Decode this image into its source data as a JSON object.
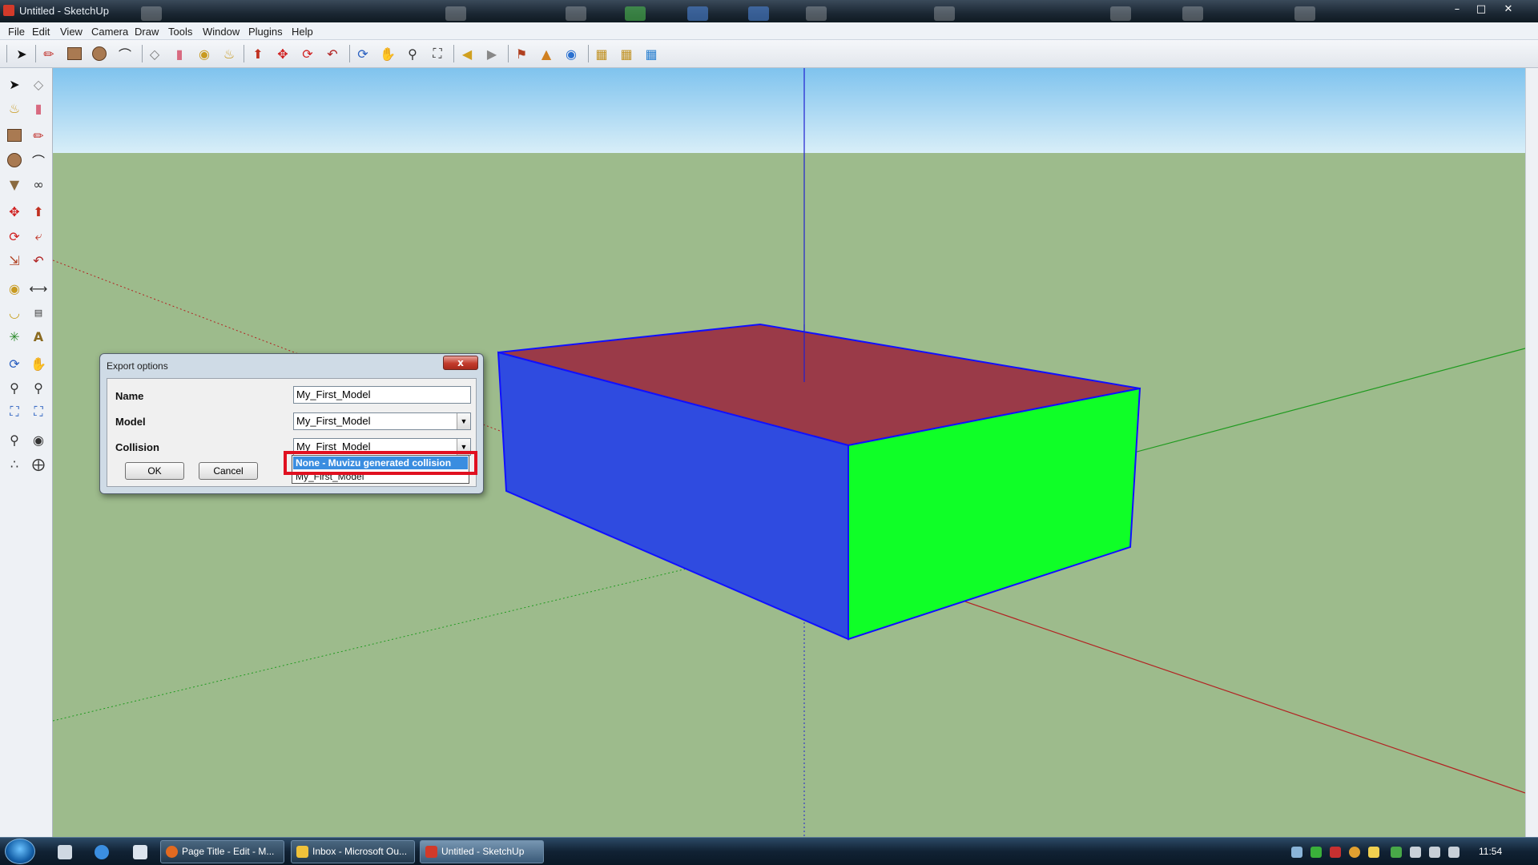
{
  "window": {
    "title": "Untitled - SketchUp",
    "minimize_label": "–",
    "maximize_label": "□",
    "close_label": "✕"
  },
  "menu": [
    {
      "label": "File"
    },
    {
      "label": "Edit"
    },
    {
      "label": "View"
    },
    {
      "label": "Camera"
    },
    {
      "label": "Draw"
    },
    {
      "label": "Tools"
    },
    {
      "label": "Window"
    },
    {
      "label": "Plugins"
    },
    {
      "label": "Help"
    }
  ],
  "toolbar_icons": [
    "select-icon",
    "pencil-icon",
    "rectangle-icon",
    "circle-icon",
    "arc-icon",
    "make-component-icon",
    "eraser-icon",
    "tape-measure-icon",
    "paint-bucket-icon",
    "push-pull-icon",
    "move-icon",
    "rotate-icon",
    "offset-icon",
    "orbit-icon",
    "pan-icon",
    "zoom-icon",
    "zoom-extents-icon",
    "previous-view-icon",
    "next-view-icon",
    "add-location-icon",
    "toggle-terrain-icon",
    "google-earth-icon",
    "get-models-icon",
    "share-model-icon",
    "share-component-icon"
  ],
  "left_toolbar_icons": [
    "select-icon",
    "make-component-icon",
    "paint-bucket-icon",
    "eraser-icon",
    "rectangle-icon",
    "line-icon",
    "circle-icon",
    "arc-icon",
    "polygon-icon",
    "freehand-icon",
    "move-icon",
    "push-pull-icon",
    "rotate-icon",
    "follow-me-icon",
    "scale-icon",
    "offset-icon",
    "tape-measure-icon",
    "dimension-icon",
    "protractor-icon",
    "text-icon",
    "axes-icon",
    "3d-text-icon",
    "orbit-icon",
    "pan-icon",
    "zoom-icon",
    "zoom-window-icon",
    "zoom-extents-icon",
    "previous-icon",
    "position-camera-icon",
    "look-around-icon",
    "walk-icon",
    "section-plane-icon"
  ],
  "dialog": {
    "title": "Export options",
    "close_label": "x",
    "fields": [
      {
        "label": "Name",
        "value": "My_First_Model"
      },
      {
        "label": "Model",
        "value": "My_First_Model"
      },
      {
        "label": "Collision",
        "value": "My_First_Model"
      }
    ],
    "ok_label": "OK",
    "cancel_label": "Cancel",
    "dropdown_options": [
      "None - Muvizu generated collision",
      "My_First_Model"
    ]
  },
  "scene": {
    "sky_color": "#bfe3f6",
    "ground_color": "#9dbb8c",
    "box_top_color": "#9a3a48",
    "box_left_color": "#2f4be0",
    "box_right_color": "#0fff27",
    "edge_color": "#1010ff"
  },
  "taskbar": {
    "tasks": [
      {
        "label": "Page Title - Edit - M...",
        "icon": "firefox-icon"
      },
      {
        "label": "Inbox - Microsoft Ou...",
        "icon": "outlook-icon"
      },
      {
        "label": "Untitled - SketchUp",
        "icon": "sketchup-icon"
      }
    ],
    "clock": "11:54"
  }
}
